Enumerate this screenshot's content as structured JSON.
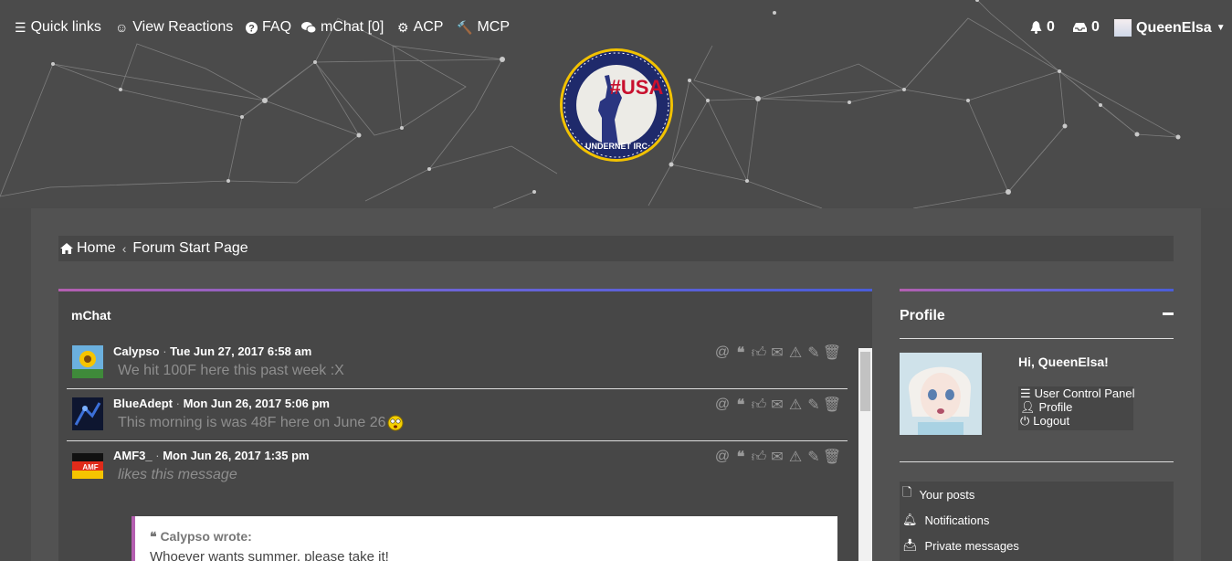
{
  "nav": {
    "quick_links": "Quick links",
    "view_reactions": "View Reactions",
    "faq": "FAQ",
    "mchat": "mChat [0]",
    "acp": "ACP",
    "mcp": "MCP",
    "notifications_count": "0",
    "messages_count": "0",
    "username": "QueenElsa"
  },
  "logo": {
    "top_text": "#USA",
    "bottom_text": "UNDERNET IRC"
  },
  "breadcrumb": {
    "home": "Home",
    "sep": "‹",
    "forum": "Forum Start Page"
  },
  "mchat": {
    "title": "mChat",
    "messages": [
      {
        "author": "Calypso",
        "time": "Tue Jun 27, 2017 6:58 am",
        "text": "We hit 100F here this past week :X"
      },
      {
        "author": "BlueAdept",
        "time": "Mon Jun 26, 2017 5:06 pm",
        "text": "This morning is was 48F here on June 26"
      },
      {
        "author": "AMF3_",
        "time": "Mon Jun 26, 2017 1:35 pm",
        "text": "likes this message"
      }
    ],
    "quote": {
      "author": "Calypso wrote:",
      "text": "Whoever wants summer, please take it!"
    }
  },
  "profile": {
    "title": "Profile",
    "greeting": "Hi, QueenElsa!",
    "links": [
      "User Control Panel",
      "Profile",
      "Logout"
    ],
    "menu": [
      "Your posts",
      "Notifications",
      "Private messages"
    ]
  },
  "colors": {
    "accent_gradient_start": "#b45fb0",
    "accent_gradient_end": "#4a5dd8",
    "background": "#4a4a4a"
  }
}
